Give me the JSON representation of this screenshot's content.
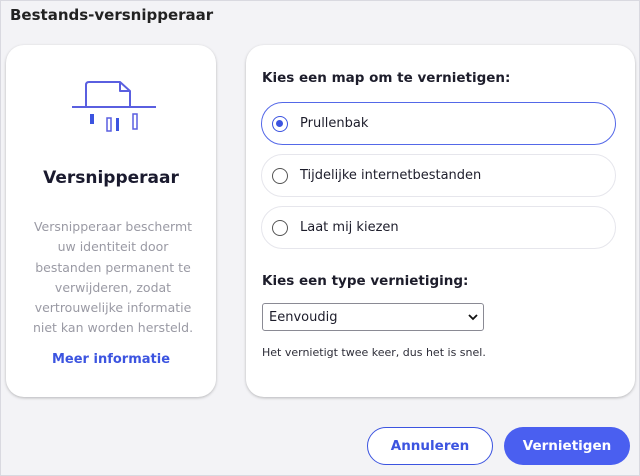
{
  "window": {
    "title": "Bestands-versnipperaar"
  },
  "info_card": {
    "icon": "shredder-icon",
    "title": "Versnipperaar",
    "description": "Versnipperaar beschermt uw identiteit door bestanden permanent te verwijderen, zodat vertrouwelijke informatie niet kan worden hersteld.",
    "link": "Meer informatie"
  },
  "folder_section": {
    "label": "Kies een map om te vernietigen:",
    "options": [
      {
        "label": "Prullenbak",
        "selected": true
      },
      {
        "label": "Tijdelijke internetbestanden",
        "selected": false
      },
      {
        "label": "Laat mij kiezen",
        "selected": false
      }
    ]
  },
  "type_section": {
    "label": "Kies een type vernietiging:",
    "selected": "Eenvoudig",
    "hint": "Het vernietigt twee keer, dus het is snel."
  },
  "buttons": {
    "cancel": "Annuleren",
    "confirm": "Vernietigen"
  },
  "colors": {
    "accent": "#3c54e0",
    "primary_button": "#4a5ff0",
    "background": "#f3f3f6"
  }
}
